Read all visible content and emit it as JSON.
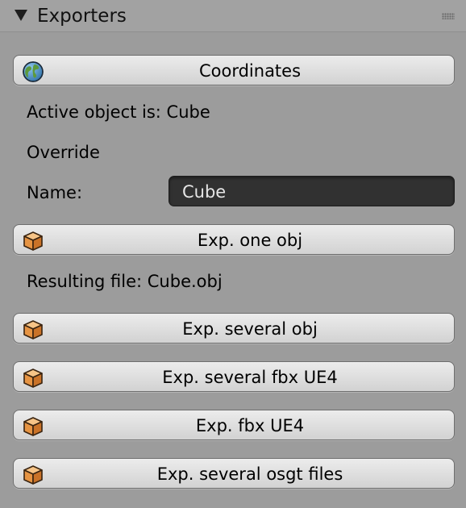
{
  "panel": {
    "title": "Exporters",
    "collapse_icon": "triangle-down-icon",
    "drag_icon": "grip-icon"
  },
  "coordinates_button": {
    "label": "Coordinates",
    "icon": "world-icon"
  },
  "active_object_text": "Active object is: Cube",
  "override_label": "Override",
  "name_field": {
    "label": "Name:",
    "value": "Cube"
  },
  "export_one_button": {
    "label": "Exp. one obj",
    "icon": "cube-icon"
  },
  "resulting_file_text": "Resulting file: Cube.obj",
  "export_buttons": [
    {
      "label": "Exp. several obj",
      "icon": "cube-icon"
    },
    {
      "label": "Exp. several fbx UE4",
      "icon": "cube-icon"
    },
    {
      "label": "Exp. fbx UE4",
      "icon": "cube-icon"
    },
    {
      "label": "Exp. several osgt files",
      "icon": "cube-icon"
    }
  ],
  "colors": {
    "panel_background": "#9c9c9c",
    "button_background": "#e0e0e0",
    "input_background": "#313131",
    "cube_icon_orange": "#e79a45"
  }
}
